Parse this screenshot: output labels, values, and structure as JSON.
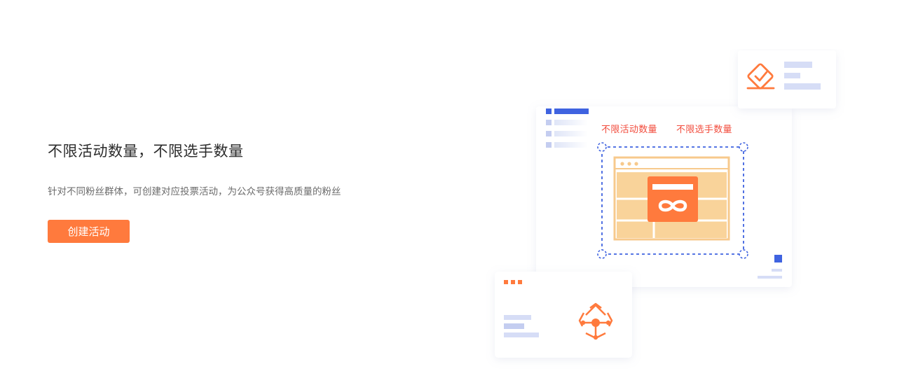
{
  "hero": {
    "title": "不限活动数量，不限选手数量",
    "subtitle": "针对不同粉丝群体，可创建对应投票活动，为公众号获得高质量的粉丝",
    "cta_label": "创建活动"
  },
  "illustration": {
    "caption_activity": "不限活动数量",
    "caption_player": "不限选手数量"
  },
  "colors": {
    "accent": "#ff7a3d",
    "caption": "#f24c3d",
    "blue": "#3f63e0",
    "light_blue": "#d6ddf6",
    "peach": "#f9d39a"
  }
}
